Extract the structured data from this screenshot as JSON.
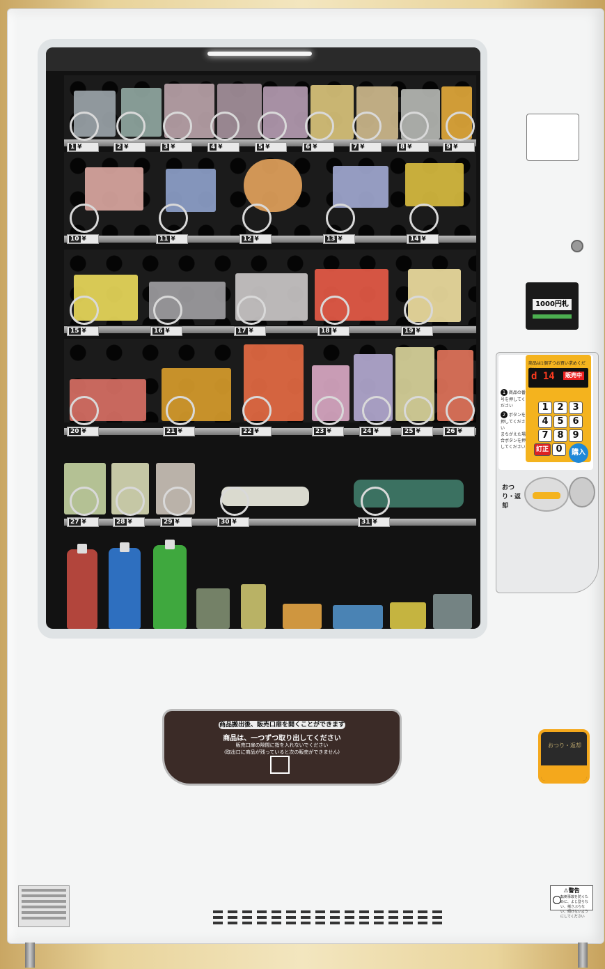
{
  "machine": {
    "bill_acceptor_label": "1000円札",
    "slot_labels": [
      {
        "num": "1",
        "price": "¥"
      },
      {
        "num": "2",
        "price": "¥"
      },
      {
        "num": "3",
        "price": "¥"
      },
      {
        "num": "4",
        "price": "¥"
      },
      {
        "num": "5",
        "price": "¥"
      },
      {
        "num": "6",
        "price": "¥"
      },
      {
        "num": "7",
        "price": "¥"
      },
      {
        "num": "8",
        "price": "¥"
      },
      {
        "num": "9",
        "price": "¥"
      },
      {
        "num": "10",
        "price": "¥"
      },
      {
        "num": "11",
        "price": "¥"
      },
      {
        "num": "12",
        "price": "¥"
      },
      {
        "num": "13",
        "price": "¥"
      },
      {
        "num": "14",
        "price": "¥"
      },
      {
        "num": "15",
        "price": "¥"
      },
      {
        "num": "16",
        "price": "¥"
      },
      {
        "num": "17",
        "price": "¥"
      },
      {
        "num": "18",
        "price": "¥"
      },
      {
        "num": "19",
        "price": "¥"
      },
      {
        "num": "20",
        "price": "¥"
      },
      {
        "num": "21",
        "price": "¥"
      },
      {
        "num": "22",
        "price": "¥"
      },
      {
        "num": "23",
        "price": "¥"
      },
      {
        "num": "24",
        "price": "¥"
      },
      {
        "num": "25",
        "price": "¥"
      },
      {
        "num": "26",
        "price": "¥"
      },
      {
        "num": "27",
        "price": "¥"
      },
      {
        "num": "28",
        "price": "¥"
      },
      {
        "num": "29",
        "price": "¥"
      },
      {
        "num": "30",
        "price": "¥"
      },
      {
        "num": "31",
        "price": "¥"
      }
    ]
  },
  "control_panel": {
    "notice": "商品は1個ずつお買い求めください",
    "display_digits": "d 14",
    "display_status": "販売中",
    "step1": "商品の番号を押してください",
    "step2": "ボタンを押してください",
    "step3": "まちがえた場合ボタンを押してください",
    "keys": [
      "1",
      "2",
      "3",
      "4",
      "5",
      "6",
      "7",
      "8",
      "9"
    ],
    "key_zero": "0",
    "key_correct": "訂正",
    "buy_button": "購入",
    "return_label": "おつり・返却"
  },
  "product_door": {
    "line1": "商品搬出後、販売口扉を開くことができます",
    "line2": "商品は、一つずつ取り出してください",
    "line3": "販売口扉の隙間に指を入れないでください",
    "line4": "(取出口に商品が残っていると次の販売ができません)"
  },
  "change_cup": {
    "label": "おつり・返却"
  },
  "warning_plate": {
    "title": "⚠警告",
    "text": "転倒事故を防ぐために、よじ登らない、揺さぶらない、傾けないようにしてください"
  },
  "colors": {
    "accent_yellow": "#f4b31e",
    "buy_blue": "#1e88d8",
    "door_brown": "#3b2b27"
  }
}
